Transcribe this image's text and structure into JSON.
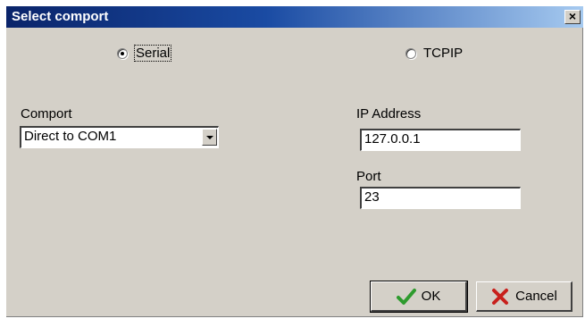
{
  "dialog": {
    "title": "Select comport",
    "close_glyph": "×"
  },
  "connection": {
    "serial_label": "Serial",
    "tcpip_label": "TCPIP",
    "selected": "Serial"
  },
  "comport": {
    "label": "Comport",
    "value": "Direct to COM1"
  },
  "ip": {
    "label": "IP Address",
    "value": "127.0.0.1"
  },
  "port": {
    "label": "Port",
    "value": "23"
  },
  "buttons": {
    "ok_label": "OK",
    "ok_icon": "check-icon",
    "cancel_label": "Cancel",
    "cancel_icon": "x-icon"
  },
  "colors": {
    "title_bar_start": "#0a246a",
    "title_bar_end": "#a6caf0",
    "dialog_face": "#d4d0c8",
    "check_green": "#2e9b2e",
    "cancel_red": "#c8201c"
  }
}
